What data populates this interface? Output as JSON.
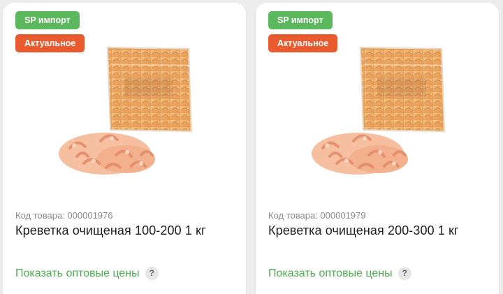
{
  "colors": {
    "badge_import": "#5cb85c",
    "badge_actual": "#e95a2e",
    "link": "#4caf50"
  },
  "products": [
    {
      "badges": {
        "import": "SP импорт",
        "actual": "Актуальное"
      },
      "image_icon": "shrimp-product-image",
      "code": "Код товара: 000001976",
      "title": "Креветка очищеная 100-200 1 кг",
      "wholesale_link": "Показать оптовые цены",
      "help_icon": "?"
    },
    {
      "badges": {
        "import": "SP импорт",
        "actual": "Актуальное"
      },
      "image_icon": "shrimp-product-image",
      "code": "Код товара: 000001979",
      "title": "Креветка очищеная 200-300 1 кг",
      "wholesale_link": "Показать оптовые цены",
      "help_icon": "?"
    }
  ]
}
